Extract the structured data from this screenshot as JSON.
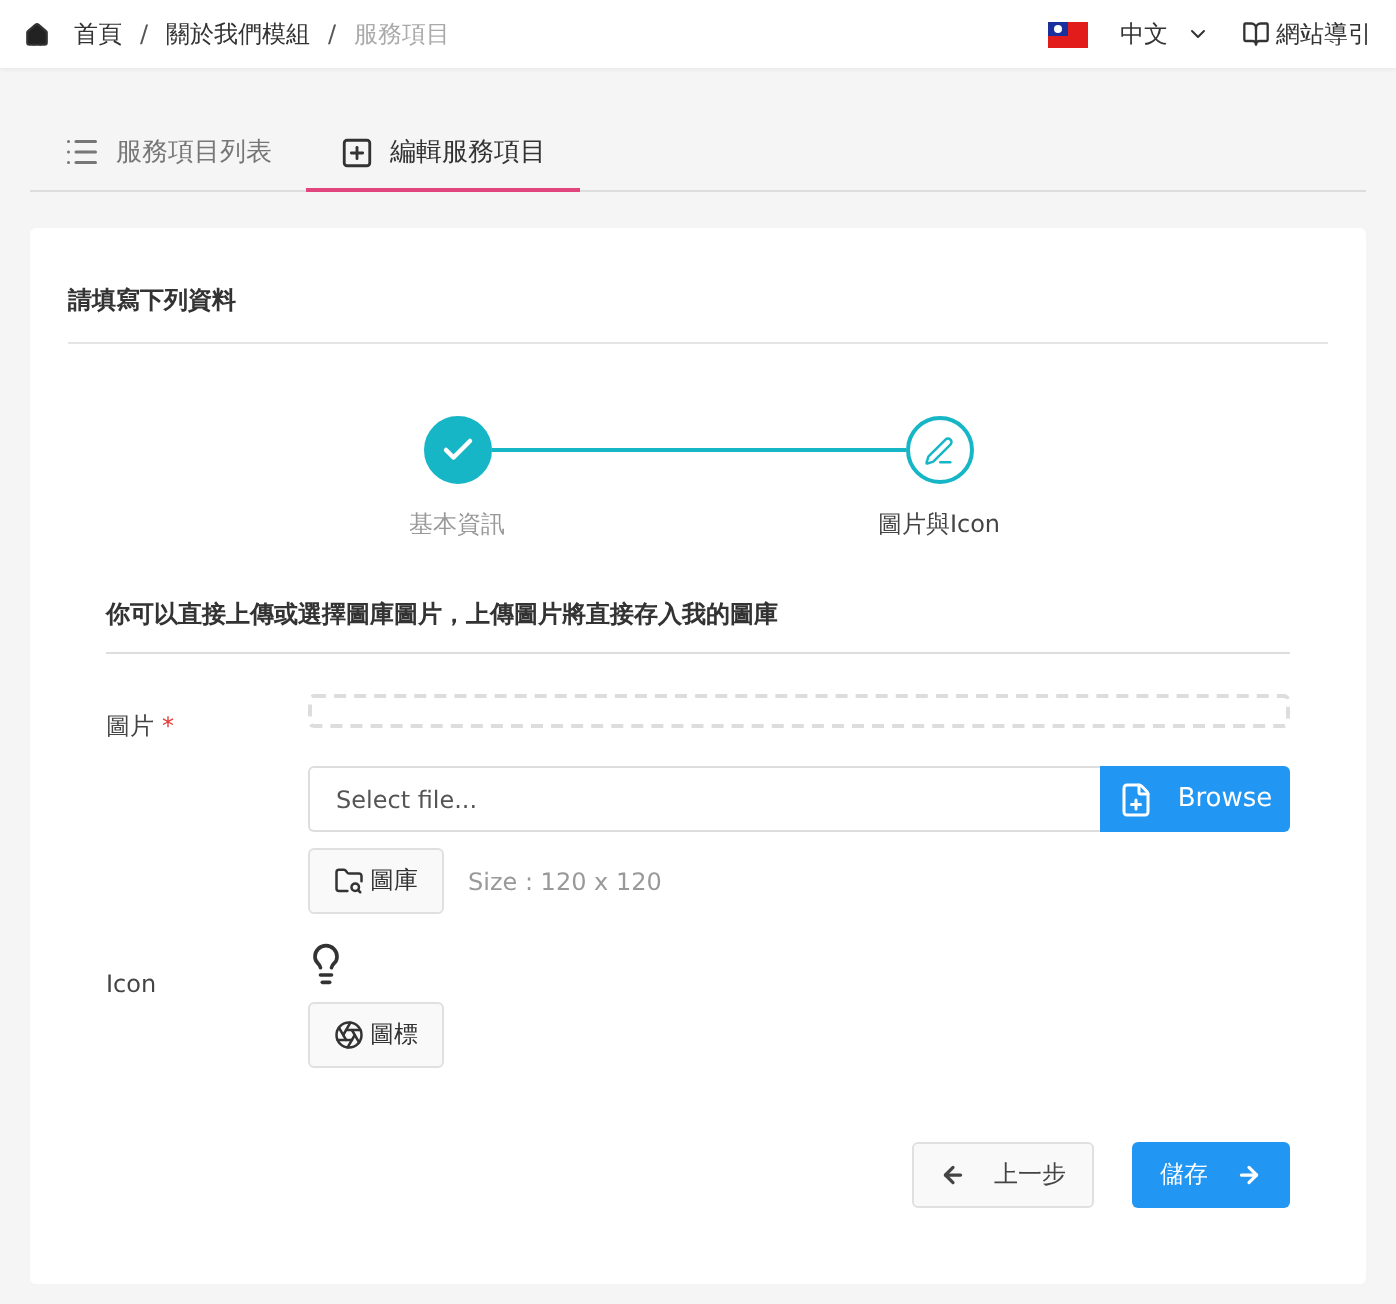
{
  "breadcrumb": [
    {
      "label": "首頁",
      "current": false
    },
    {
      "label": "關於我們模組",
      "current": false
    },
    {
      "label": "服務項目",
      "current": true
    }
  ],
  "breadcrumb_separator": "/",
  "language": "中文",
  "guide": "網站導引",
  "tabs": [
    {
      "label": "服務項目列表",
      "selected": false,
      "kind": "list"
    },
    {
      "label": "編輯服務項目",
      "selected": true,
      "kind": "edit"
    }
  ],
  "card_title": "請填寫下列資料",
  "steps": [
    {
      "label": "基本資訊",
      "done": true
    },
    {
      "label": "圖片與Icon",
      "done": false
    }
  ],
  "section_title": "你可以直接上傳或選擇圖庫圖片，上傳圖片將直接存入我的圖庫",
  "image_field": {
    "label": "圖片",
    "required_mark": "*",
    "placeholder": "Select file...",
    "browse": "Browse",
    "gallery": "圖庫",
    "size_hint": "Size : 120 x 120"
  },
  "icon_field": {
    "label": "Icon",
    "button": "圖標"
  },
  "buttons": {
    "back": "上一步",
    "save": "儲存"
  }
}
